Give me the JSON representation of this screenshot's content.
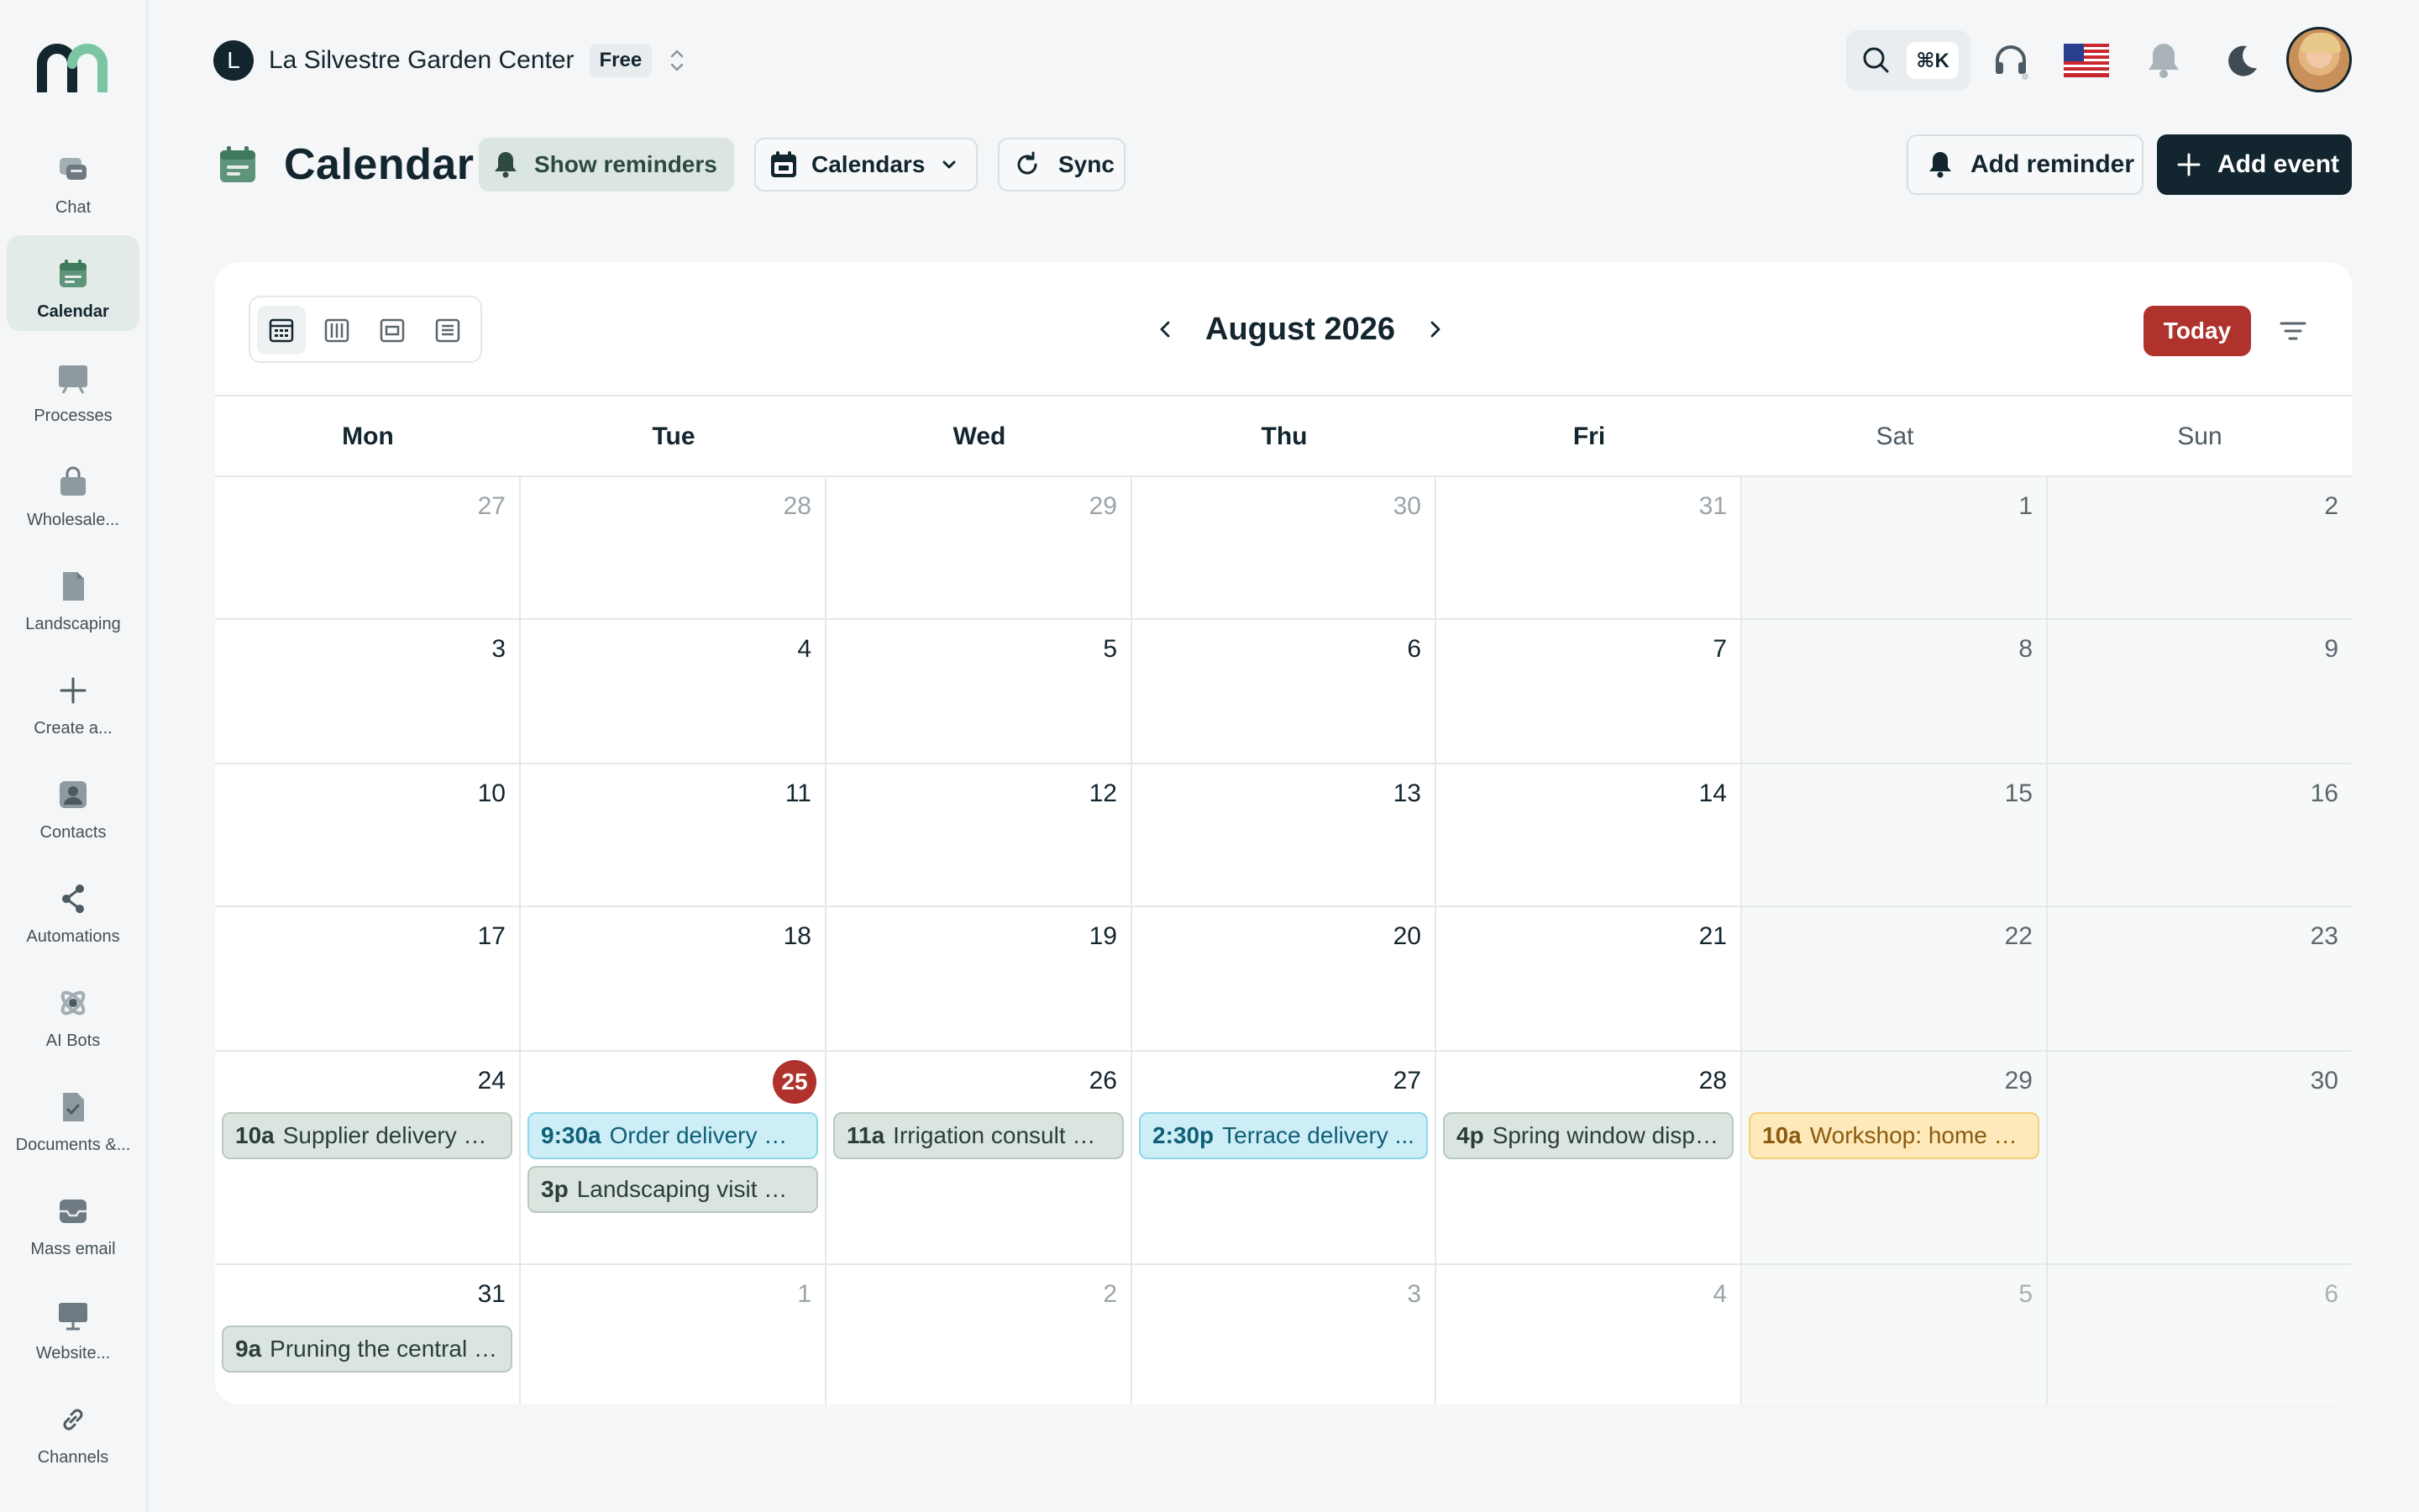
{
  "app": {
    "brand_icon": "m-logo-icon"
  },
  "org": {
    "initial": "L",
    "name": "La Silvestre Garden Center",
    "plan": "Free"
  },
  "search": {
    "shortcut": "⌘K"
  },
  "sidebar": {
    "items": [
      {
        "label": "Chat",
        "icon": "chat-icon",
        "active": false
      },
      {
        "label": "Calendar",
        "icon": "calendar-icon",
        "active": true
      },
      {
        "label": "Processes",
        "icon": "board-icon",
        "active": false
      },
      {
        "label": "Wholesale...",
        "icon": "shopping-bag-icon",
        "active": false
      },
      {
        "label": "Landscaping",
        "icon": "document-icon",
        "active": false
      },
      {
        "label": "Create a...",
        "icon": "plus-icon",
        "active": false
      },
      {
        "label": "Contacts",
        "icon": "contact-icon",
        "active": false
      },
      {
        "label": "Automations",
        "icon": "share-icon",
        "active": false
      },
      {
        "label": "AI Bots",
        "icon": "atom-icon",
        "active": false
      },
      {
        "label": "Documents &...",
        "icon": "document-check-icon",
        "active": false
      },
      {
        "label": "Mass email",
        "icon": "inbox-icon",
        "active": false
      },
      {
        "label": "Website...",
        "icon": "monitor-icon",
        "active": false
      },
      {
        "label": "Channels",
        "icon": "link-icon",
        "active": false
      }
    ]
  },
  "page": {
    "title": "Calendar"
  },
  "toolbar": {
    "show_reminders": "Show reminders",
    "calendars": "Calendars",
    "sync": "Sync",
    "add_reminder": "Add reminder",
    "add_event": "Add event"
  },
  "calendar": {
    "month_label": "August 2026",
    "today_label": "Today",
    "view_modes": [
      "month-view-icon",
      "week-view-icon",
      "day-view-icon",
      "agenda-view-icon"
    ],
    "weekdays": [
      "Mon",
      "Tue",
      "Wed",
      "Thu",
      "Fri",
      "Sat",
      "Sun"
    ],
    "weeks": [
      [
        {
          "d": "27",
          "muted": true
        },
        {
          "d": "28",
          "muted": true
        },
        {
          "d": "29",
          "muted": true
        },
        {
          "d": "30",
          "muted": true
        },
        {
          "d": "31",
          "muted": true
        },
        {
          "d": "1"
        },
        {
          "d": "2"
        }
      ],
      [
        {
          "d": "3"
        },
        {
          "d": "4"
        },
        {
          "d": "5"
        },
        {
          "d": "6"
        },
        {
          "d": "7"
        },
        {
          "d": "8"
        },
        {
          "d": "9"
        }
      ],
      [
        {
          "d": "10"
        },
        {
          "d": "11"
        },
        {
          "d": "12"
        },
        {
          "d": "13"
        },
        {
          "d": "14"
        },
        {
          "d": "15"
        },
        {
          "d": "16"
        }
      ],
      [
        {
          "d": "17"
        },
        {
          "d": "18"
        },
        {
          "d": "19"
        },
        {
          "d": "20"
        },
        {
          "d": "21"
        },
        {
          "d": "22"
        },
        {
          "d": "23"
        }
      ],
      [
        {
          "d": "24",
          "events": [
            {
              "time": "10a",
              "title": "Supplier delivery — p...",
              "color": "green"
            }
          ]
        },
        {
          "d": "25",
          "today": true,
          "events": [
            {
              "time": "9:30a",
              "title": "Order delivery — ...",
              "color": "cyan"
            },
            {
              "time": "3p",
              "title": "Landscaping visit — R...",
              "color": "green"
            }
          ]
        },
        {
          "d": "26",
          "events": [
            {
              "time": "11a",
              "title": "Irrigation consult — ...",
              "color": "green"
            }
          ]
        },
        {
          "d": "27",
          "events": [
            {
              "time": "2:30p",
              "title": "Terrace delivery ...",
              "color": "cyan"
            }
          ]
        },
        {
          "d": "28",
          "events": [
            {
              "time": "4p",
              "title": "Spring window displa...",
              "color": "green"
            }
          ]
        },
        {
          "d": "29",
          "events": [
            {
              "time": "10a",
              "title": "Workshop: home ve...",
              "color": "yellow"
            }
          ]
        },
        {
          "d": "30"
        }
      ],
      [
        {
          "d": "31",
          "events": [
            {
              "time": "9a",
              "title": "Pruning the central pl...",
              "color": "green"
            }
          ]
        },
        {
          "d": "1",
          "muted": true
        },
        {
          "d": "2",
          "muted": true
        },
        {
          "d": "3",
          "muted": true
        },
        {
          "d": "4",
          "muted": true
        },
        {
          "d": "5",
          "muted": true
        },
        {
          "d": "6",
          "muted": true
        }
      ]
    ]
  },
  "colors": {
    "accent": "#13252e",
    "today": "#b0322c",
    "active_nav": "#e2ebe7"
  }
}
